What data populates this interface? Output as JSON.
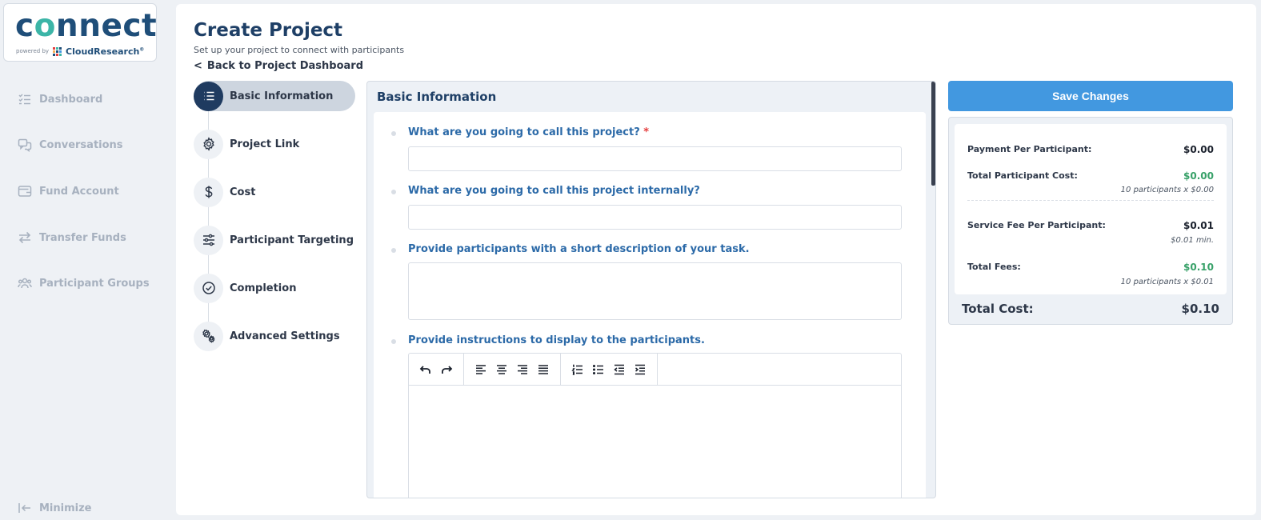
{
  "logo": {
    "word": "connect",
    "tm": "™",
    "powered_by": "powered by",
    "brand": "CloudResearch",
    "brand_mark": "®"
  },
  "sidebar": {
    "items": [
      {
        "label": "Dashboard",
        "icon": "list-check-icon"
      },
      {
        "label": "Conversations",
        "icon": "chat-icon"
      },
      {
        "label": "Fund Account",
        "icon": "wallet-icon"
      },
      {
        "label": "Transfer Funds",
        "icon": "transfer-icon"
      },
      {
        "label": "Participant Groups",
        "icon": "group-icon"
      }
    ],
    "minimize_label": "Minimize"
  },
  "header": {
    "title": "Create Project",
    "subtitle": "Set up your project to connect with participants",
    "back_link": "Back to Project Dashboard"
  },
  "steps": [
    {
      "label": "Basic Information",
      "icon": "list-icon",
      "active": true
    },
    {
      "label": "Project Link",
      "icon": "gear-icon",
      "active": false
    },
    {
      "label": "Cost",
      "icon": "dollar-icon",
      "active": false
    },
    {
      "label": "Participant Targeting",
      "icon": "sliders-icon",
      "active": false
    },
    {
      "label": "Completion",
      "icon": "check-circle-icon",
      "active": false
    },
    {
      "label": "Advanced Settings",
      "icon": "gears-icon",
      "active": false
    }
  ],
  "form": {
    "header": "Basic Information",
    "questions": {
      "project_name": {
        "label": "What are you going to call this project?",
        "required_mark": "*",
        "value": ""
      },
      "internal_name": {
        "label": "What are you going to call this project internally?",
        "value": ""
      },
      "short_description": {
        "label": "Provide participants with a short description of your task.",
        "value": ""
      },
      "instructions": {
        "label": "Provide instructions to display to the participants.",
        "value": ""
      }
    }
  },
  "summary": {
    "save_label": "Save Changes",
    "payment_per_participant": {
      "label": "Payment Per Participant:",
      "value": "$0.00"
    },
    "total_participant_cost": {
      "label": "Total Participant Cost:",
      "value": "$0.00",
      "note": "10 participants x $0.00"
    },
    "service_fee": {
      "label": "Service Fee Per Participant:",
      "value": "$0.01",
      "note": "$0.01 min."
    },
    "total_fees": {
      "label": "Total Fees:",
      "value": "$0.10",
      "note": "10 participants x $0.01"
    },
    "total_cost": {
      "label": "Total Cost:",
      "value": "$0.10"
    }
  },
  "colors": {
    "primary_dark": "#1f3b60",
    "accent_blue": "#4298e0",
    "label_blue": "#2c6aa8",
    "green": "#38a169",
    "required_red": "#e53e3e"
  }
}
